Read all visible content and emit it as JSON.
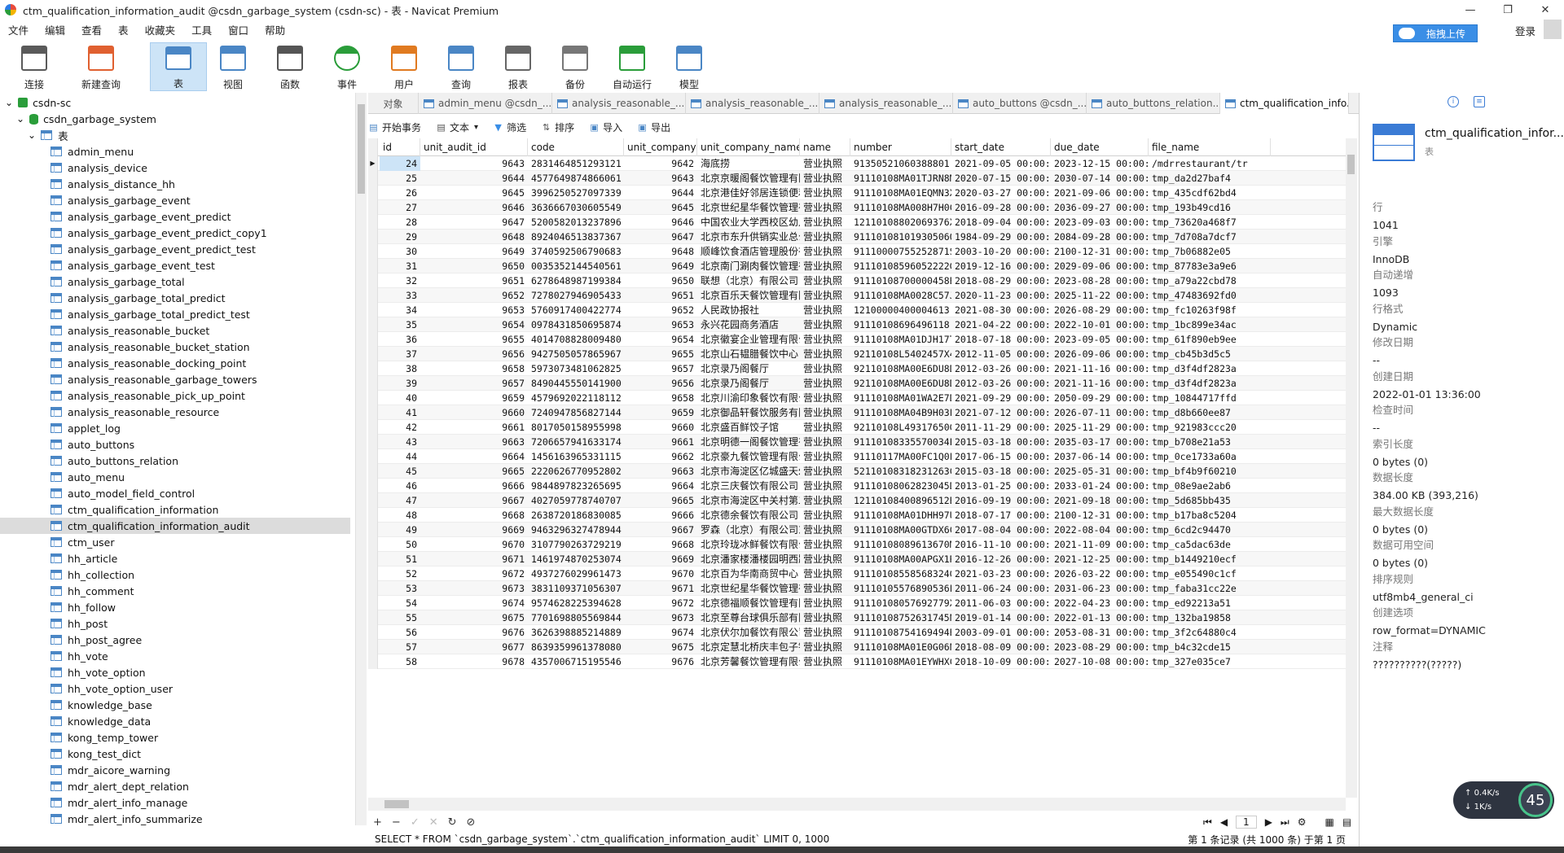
{
  "window": {
    "title": "ctm_qualification_information_audit @csdn_garbage_system (csdn-sc) - 表 - Navicat Premium"
  },
  "menu": [
    "文件",
    "编辑",
    "查看",
    "表",
    "收藏夹",
    "工具",
    "窗口",
    "帮助"
  ],
  "toolbar": [
    {
      "label": "连接",
      "icon": "connection-icon"
    },
    {
      "label": "新建查询",
      "icon": "new-query-icon"
    },
    {
      "label": "表",
      "icon": "table-icon"
    },
    {
      "label": "视图",
      "icon": "view-icon"
    },
    {
      "label": "函数",
      "icon": "function-icon"
    },
    {
      "label": "事件",
      "icon": "event-clock-icon"
    },
    {
      "label": "用户",
      "icon": "user-icon"
    },
    {
      "label": "查询",
      "icon": "query-icon"
    },
    {
      "label": "报表",
      "icon": "report-icon"
    },
    {
      "label": "备份",
      "icon": "backup-icon"
    },
    {
      "label": "自动运行",
      "icon": "automation-icon"
    },
    {
      "label": "模型",
      "icon": "model-icon"
    }
  ],
  "upload": {
    "label": "拖拽上传"
  },
  "login": {
    "label": "登录"
  },
  "tree": {
    "connection": "csdn-sc",
    "database": "csdn_garbage_system",
    "tables_node": "表",
    "selected": "ctm_qualification_information_audit",
    "tables": [
      "admin_menu",
      "analysis_device",
      "analysis_distance_hh",
      "analysis_garbage_event",
      "analysis_garbage_event_predict",
      "analysis_garbage_event_predict_copy1",
      "analysis_garbage_event_predict_test",
      "analysis_garbage_event_test",
      "analysis_garbage_total",
      "analysis_garbage_total_predict",
      "analysis_garbage_total_predict_test",
      "analysis_reasonable_bucket",
      "analysis_reasonable_bucket_station",
      "analysis_reasonable_docking_point",
      "analysis_reasonable_garbage_towers",
      "analysis_reasonable_pick_up_point",
      "analysis_reasonable_resource",
      "applet_log",
      "auto_buttons",
      "auto_buttons_relation",
      "auto_menu",
      "auto_model_field_control",
      "ctm_qualification_information",
      "ctm_qualification_information_audit",
      "ctm_user",
      "hh_article",
      "hh_collection",
      "hh_comment",
      "hh_follow",
      "hh_post",
      "hh_post_agree",
      "hh_vote",
      "hh_vote_option",
      "hh_vote_option_user",
      "knowledge_base",
      "knowledge_data",
      "kong_temp_tower",
      "kong_test_dict",
      "mdr_aicore_warning",
      "mdr_alert_dept_relation",
      "mdr_alert_info_manage",
      "mdr_alert_info_summarize"
    ]
  },
  "tabs": [
    "对象",
    "admin_menu @csdn_...",
    "analysis_reasonable_...",
    "analysis_reasonable_...",
    "analysis_reasonable_...",
    "auto_buttons @csdn_...",
    "auto_buttons_relation...",
    "ctm_qualification_info..."
  ],
  "grid_toolbar": [
    "开始事务",
    "文本",
    "筛选",
    "排序",
    "导入",
    "导出"
  ],
  "grid": {
    "columns": [
      "id",
      "unit_audit_id",
      "code",
      "unit_company",
      "unit_company_name",
      "name",
      "number",
      "start_date",
      "due_date",
      "file_name"
    ],
    "rows": [
      [
        "24",
        "9643",
        "2831464851293121",
        "9642",
        "海底捞",
        "营业执照",
        "91350521060388801",
        "2021-09-05 00:00:00",
        "2023-12-15 00:00:00",
        "/mdrrestaurant/tr"
      ],
      [
        "25",
        "9644",
        "4577649874866061",
        "9643",
        "北京京暖阁餐饮管理有限公司",
        "营业执照",
        "91110108MA01TJRN8M",
        "2020-07-15 00:00:00",
        "2030-07-14 00:00:00",
        "tmp_da2d27baf4"
      ],
      [
        "26",
        "9645",
        "3996250527097339",
        "9644",
        "北京港佳好邻居连锁便利店",
        "营业执照",
        "91110108MA01EQMN3X",
        "2020-03-27 00:00:00",
        "2021-09-06 00:00:00",
        "tmp_435cdf62bd4"
      ],
      [
        "27",
        "9646",
        "3636667030605549",
        "9645",
        "北京世纪星华餐饮管理有限公司",
        "营业执照",
        "91110108MA008H7H0C",
        "2016-09-28 00:00:00",
        "2036-09-27 00:00:00",
        "tmp_193b49cd16"
      ],
      [
        "28",
        "9647",
        "5200582013237896",
        "9646",
        "中国农业大学西校区幼儿园",
        "营业执照",
        "12110108802069376X",
        "2018-09-04 00:00:00",
        "2023-09-03 00:00:00",
        "tmp_73620a468f7"
      ],
      [
        "29",
        "9648",
        "8924046513837367",
        "9647",
        "北京市东升供销实业总公司",
        "营业执照",
        "91110108101930506Q",
        "1984-09-29 00:00:00",
        "2084-09-28 00:00:00",
        "tmp_7d708a7dcf7"
      ],
      [
        "30",
        "9649",
        "3740592506790683",
        "9648",
        "顺峰饮食酒店管理股份有限公司",
        "营业执照",
        "91110000755252871S",
        "2003-10-20 00:00:00",
        "2100-12-31 00:00:00",
        "tmp_7b06882e05"
      ],
      [
        "31",
        "9650",
        "0035352144540561",
        "9649",
        "北京南门涮肉餐饮管理有限公司",
        "营业执照",
        "91110108596052222G",
        "2019-12-16 00:00:00",
        "2029-09-06 00:00:00",
        "tmp_87783e3a9e6"
      ],
      [
        "32",
        "9651",
        "6278648987199384",
        "9650",
        "联想（北京）有限公司",
        "营业执照",
        "91110108700000458B",
        "2018-08-29 00:00:00",
        "2023-08-28 00:00:00",
        "tmp_a79a22cbd78"
      ],
      [
        "33",
        "9652",
        "7278027946905433",
        "9651",
        "北京百乐天餐饮管理有限公司",
        "营业执照",
        "91110108MA0028C57J",
        "2020-11-23 00:00:00",
        "2025-11-22 00:00:00",
        "tmp_47483692fd0"
      ],
      [
        "34",
        "9653",
        "5760917400422774",
        "9652",
        "人民政协报社",
        "营业执照",
        "12100000400004613",
        "2021-08-30 00:00:00",
        "2026-08-29 00:00:00",
        "tmp_fc10263f98f"
      ],
      [
        "35",
        "9654",
        "0978431850695874",
        "9653",
        "永兴花园商务酒店",
        "营业执照",
        "91110108696496118",
        "2021-04-22 00:00:00",
        "2022-10-01 00:00:00",
        "tmp_1bc899e34ac"
      ],
      [
        "36",
        "9655",
        "4014708828009480",
        "9654",
        "北京徽宴企业管理有限公司",
        "营业执照",
        "91110108MA01DJH17T",
        "2018-07-18 00:00:00",
        "2023-09-05 00:00:00",
        "tmp_61f890eb9ee"
      ],
      [
        "37",
        "9656",
        "9427505057865967",
        "9655",
        "北京山石韫腊餐饮中心",
        "营业执照",
        "92110108L5402457X4",
        "2012-11-05 00:00:00",
        "2026-09-06 00:00:00",
        "tmp_cb45b3d5c5"
      ],
      [
        "38",
        "9658",
        "5973073481062825",
        "9657",
        "北京录乃阁餐厅",
        "营业执照",
        "92110108MA00E6DU8D",
        "2012-03-26 00:00:00",
        "2021-11-16 00:00:00",
        "tmp_d3f4df2823a"
      ],
      [
        "39",
        "9657",
        "8490445550141900",
        "9656",
        "北京录乃阁餐厅",
        "营业执照",
        "92110108MA00E6DU8D",
        "2012-03-26 00:00:00",
        "2021-11-16 00:00:00",
        "tmp_d3f4df2823a"
      ],
      [
        "40",
        "9659",
        "4579692022118112",
        "9658",
        "北京川渝印象餐饮有限公司",
        "营业执照",
        "91110108MA01WA2E7D",
        "2021-09-29 00:00:00",
        "2050-09-29 00:00:00",
        "tmp_10844717ffd"
      ],
      [
        "41",
        "9660",
        "7240947856827144",
        "9659",
        "北京御品轩餐饮服务有限公司",
        "营业执照",
        "91110108MA04B9H03L",
        "2021-07-12 00:00:00",
        "2026-07-11 00:00:00",
        "tmp_d8b660ee87"
      ],
      [
        "42",
        "9661",
        "8017050158955998",
        "9660",
        "北京盛百鲜饺子馆",
        "营业执照",
        "92110108L49317650G",
        "2011-11-29 00:00:00",
        "2025-11-29 00:00:00",
        "tmp_921983ccc20"
      ],
      [
        "43",
        "9663",
        "7206657941633174",
        "9661",
        "北京明德一阁餐饮管理有限公司",
        "营业执照",
        "91110108335570034E",
        "2015-03-18 00:00:00",
        "2035-03-17 00:00:00",
        "tmp_b708e21a53"
      ],
      [
        "44",
        "9664",
        "1456163965331115",
        "9662",
        "北京豪九餐饮管理有限公司",
        "营业执照",
        "91110117MA00FC1Q0L",
        "2017-06-15 00:00:00",
        "2037-06-14 00:00:00",
        "tmp_0ce1733a60a"
      ],
      [
        "45",
        "9665",
        "2220626770952802",
        "9663",
        "北京市海淀区亿城盛天幼儿园",
        "营业执照",
        "52110108318231263C",
        "2015-03-18 00:00:00",
        "2025-05-31 00:00:00",
        "tmp_bf4b9f60210"
      ],
      [
        "46",
        "9666",
        "9844897823265695",
        "9664",
        "北京三庆餐饮有限公司",
        "营业执照",
        "91110108062823045D",
        "2013-01-25 00:00:00",
        "2033-01-24 00:00:00",
        "tmp_08e9ae2ab6"
      ],
      [
        "47",
        "9667",
        "4027059778740707",
        "9665",
        "北京市海淀区中关村第二小学",
        "营业执照",
        "12110108400896512B",
        "2016-09-19 00:00:00",
        "2021-09-18 00:00:00",
        "tmp_5d685bb435"
      ],
      [
        "48",
        "9668",
        "2638720186830085",
        "9666",
        "北京德余餐饮有限公司",
        "营业执照",
        "91110108MA01DHH97U",
        "2018-07-17 00:00:00",
        "2100-12-31 00:00:00",
        "tmp_b17ba8c5204"
      ],
      [
        "49",
        "9669",
        "9463296327478944",
        "9667",
        "罗森（北京）有限公司东北",
        "营业执照",
        "91110108MA00GTDX6C",
        "2017-08-04 00:00:00",
        "2022-08-04 00:00:00",
        "tmp_6cd2c94470"
      ],
      [
        "50",
        "9670",
        "3107790263729219",
        "9668",
        "北京玲珑冰鲜餐饮有限公司",
        "营业执照",
        "91110108089613670M",
        "2016-11-10 00:00:00",
        "2021-11-09 00:00:00",
        "tmp_ca5dac63de"
      ],
      [
        "51",
        "9671",
        "1461974870253074",
        "9669",
        "北京潘家楼潘楼园明西路店",
        "营业执照",
        "91110108MA00APGX1R",
        "2016-12-26 00:00:00",
        "2021-12-25 00:00:00",
        "tmp_b1449210ecf"
      ],
      [
        "52",
        "9672",
        "4937276029961473",
        "9670",
        "北京百为华南商贸中心",
        "营业执照",
        "91110108558568324G",
        "2021-03-23 00:00:00",
        "2026-03-22 00:00:00",
        "tmp_e055490c1cf"
      ],
      [
        "53",
        "9673",
        "3831109371056307",
        "9671",
        "北京世纪星华餐饮管理有限公司",
        "营业执照",
        "91110105576890536L",
        "2011-06-24 00:00:00",
        "2031-06-23 00:00:00",
        "tmp_faba31cc22e"
      ],
      [
        "54",
        "9674",
        "9574628225394628",
        "9672",
        "北京德福顺餐饮管理有限公司",
        "营业执照",
        "91110108057692779XP",
        "2011-06-03 00:00:00",
        "2022-04-23 00:00:00",
        "tmp_ed92213a51"
      ],
      [
        "55",
        "9675",
        "7701698805569844",
        "9673",
        "北京至尊台球俱乐部有限责任公司",
        "营业执照",
        "91110108752631745N",
        "2019-01-14 00:00:00",
        "2022-01-13 00:00:00",
        "tmp_132ba19858"
      ],
      [
        "56",
        "9676",
        "3626398885214889",
        "9674",
        "北京伏尔加餐饮有限公司",
        "营业执照",
        "91110108754169494B",
        "2003-09-01 00:00:00",
        "2053-08-31 00:00:00",
        "tmp_3f2c64880c4"
      ],
      [
        "57",
        "9677",
        "8639359961378080",
        "9675",
        "北京定慧北桥庆丰包子铺有限公司",
        "营业执照",
        "91110108MA01E0G06N",
        "2018-08-09 00:00:00",
        "2023-08-29 00:00:00",
        "tmp_b4c32cde15"
      ],
      [
        "58",
        "9678",
        "4357006715195546",
        "9676",
        "北京芳馨餐饮管理有限公司",
        "营业执照",
        "91110108MA01EYWHXC",
        "2018-10-09 00:00:00",
        "2027-10-08 00:00:00",
        "tmp_327e035ce7"
      ]
    ]
  },
  "pager": {
    "page": "1"
  },
  "status": {
    "sql": "SELECT * FROM `csdn_garbage_system`.`ctm_qualification_information_audit` LIMIT 0, 1000",
    "records": "第 1 条记录 (共 1000 条) 于第 1 页"
  },
  "info": {
    "name": "ctm_qualification_infor...",
    "kind": "表",
    "props": [
      {
        "k": "行",
        "v": "1041"
      },
      {
        "k": "引擎",
        "v": "InnoDB"
      },
      {
        "k": "自动递增",
        "v": "1093"
      },
      {
        "k": "行格式",
        "v": "Dynamic"
      },
      {
        "k": "修改日期",
        "v": "--"
      },
      {
        "k": "创建日期",
        "v": "2022-01-01 13:36:00"
      },
      {
        "k": "检查时间",
        "v": "--"
      },
      {
        "k": "索引长度",
        "v": "0 bytes (0)"
      },
      {
        "k": "数据长度",
        "v": "384.00 KB (393,216)"
      },
      {
        "k": "最大数据长度",
        "v": "0 bytes (0)"
      },
      {
        "k": "数据可用空间",
        "v": "0 bytes (0)"
      },
      {
        "k": "排序规则",
        "v": "utf8mb4_general_ci"
      },
      {
        "k": "创建选项",
        "v": "row_format=DYNAMIC"
      },
      {
        "k": "注释",
        "v": "??????????(?????)"
      }
    ]
  },
  "speed": {
    "up": "0.4",
    "down": "1",
    "unit": "K/s",
    "percent": "45"
  }
}
